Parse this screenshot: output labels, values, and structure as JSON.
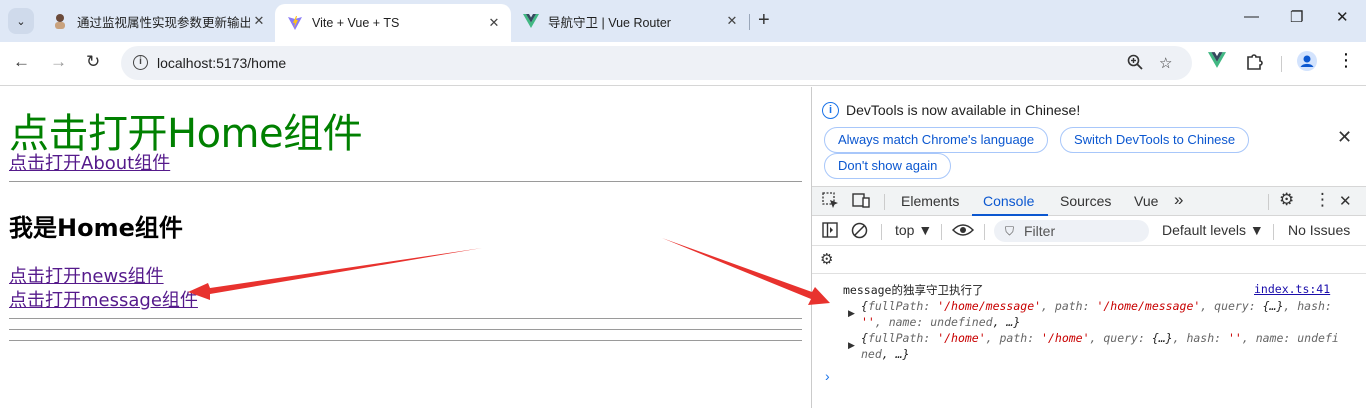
{
  "browser": {
    "tabs": [
      {
        "title": "通过监视属性实现参数更新输出",
        "active": false
      },
      {
        "title": "Vite + Vue + TS",
        "active": true
      },
      {
        "title": "导航守卫 | Vue Router",
        "active": false
      }
    ],
    "new_tab": "+",
    "url": "localhost:5173/home",
    "window_controls": {
      "minimize": "—",
      "restore": "❐",
      "close": "✕"
    }
  },
  "page": {
    "heading": "点击打开Home组件",
    "about_link": "点击打开About组件",
    "subheading": "我是Home组件",
    "news_link": "点击打开news组件",
    "message_link": "点击打开message组件"
  },
  "devtools": {
    "banner": {
      "text": "DevTools is now available in Chinese!",
      "always_match": "Always match Chrome's language",
      "switch": "Switch DevTools to Chinese",
      "dont_show": "Don't show again",
      "close": "✕"
    },
    "tabs": [
      "Elements",
      "Console",
      "Sources",
      "Vue"
    ],
    "active_tab": "Console",
    "more_tabs": "»",
    "console_toolbar": {
      "context": "top ▼",
      "filter_placeholder": "Filter",
      "levels": "Default levels ▼",
      "issues": "No Issues"
    },
    "log": {
      "message": "message的独享守卫执行了",
      "source": "index.ts:41",
      "obj1": {
        "open": "{",
        "k_fullpath": "fullPath: ",
        "v_fullpath": "'/home/message'",
        "k_path": ", path: ",
        "v_path": "'/home/message'",
        "k_query": ", query: ",
        "v_query": "{…}",
        "k_hash": ", hash: ",
        "v_hash": "''",
        "k_name": ", name: ",
        "v_name": "undefined",
        "rest": ",  …}"
      },
      "obj2": {
        "open": "{",
        "k_fullpath": "fullPath: ",
        "v_fullpath": "'/home'",
        "k_path": ", path: ",
        "v_path": "'/home'",
        "k_query": ", query: ",
        "v_query": "{…}",
        "k_hash": ", hash: ",
        "v_hash": "''",
        "k_name": ", name: ",
        "v_name": "undefined",
        "rest": ",  …}"
      },
      "prompt": "›"
    }
  },
  "colors": {
    "heading": "#008000",
    "link": "#551a8b",
    "annotation_arrow": "#e8322e",
    "devtools_accent": "#0b57d0"
  }
}
